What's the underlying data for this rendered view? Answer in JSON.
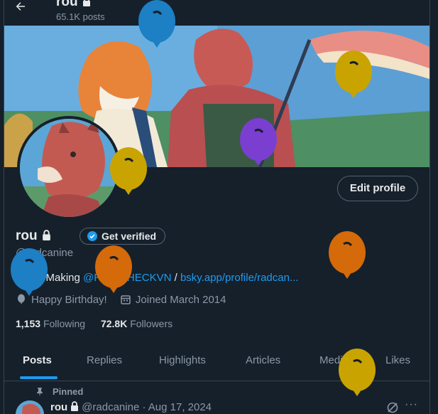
{
  "header": {
    "back_icon": "back-arrow-icon",
    "name": "rou",
    "posts": "65.1K posts"
  },
  "profile": {
    "edit_label": "Edit profile",
    "name": "rou",
    "verified_label": "Get verified",
    "handle": "@radcanine",
    "bio": {
      "prefix": "中文 / Making ",
      "mention": "@RAINCHECKVN",
      "separator": " / ",
      "link": "bsky.app/profile/radcan..."
    },
    "birthday": "Happy Birthday!",
    "joined": "Joined March 2014",
    "following_count": "1,153",
    "following_label": "Following",
    "followers_count": "72.8K",
    "followers_label": "Followers"
  },
  "tabs": [
    "Posts",
    "Replies",
    "Highlights",
    "Articles",
    "Media",
    "Likes"
  ],
  "tweet": {
    "pinned_label": "Pinned",
    "name": "rou",
    "handle_date": "@radcanine · Aug 17, 2024",
    "more": "···"
  },
  "colors": {
    "background": "#15202b",
    "accent": "#1d9bf0",
    "secondary_text": "#8b98a5",
    "balloon_blue": "#1d7fc4",
    "balloon_yellow": "#c9a400",
    "balloon_orange": "#d46a0a",
    "balloon_purple": "#7a3fd1"
  }
}
